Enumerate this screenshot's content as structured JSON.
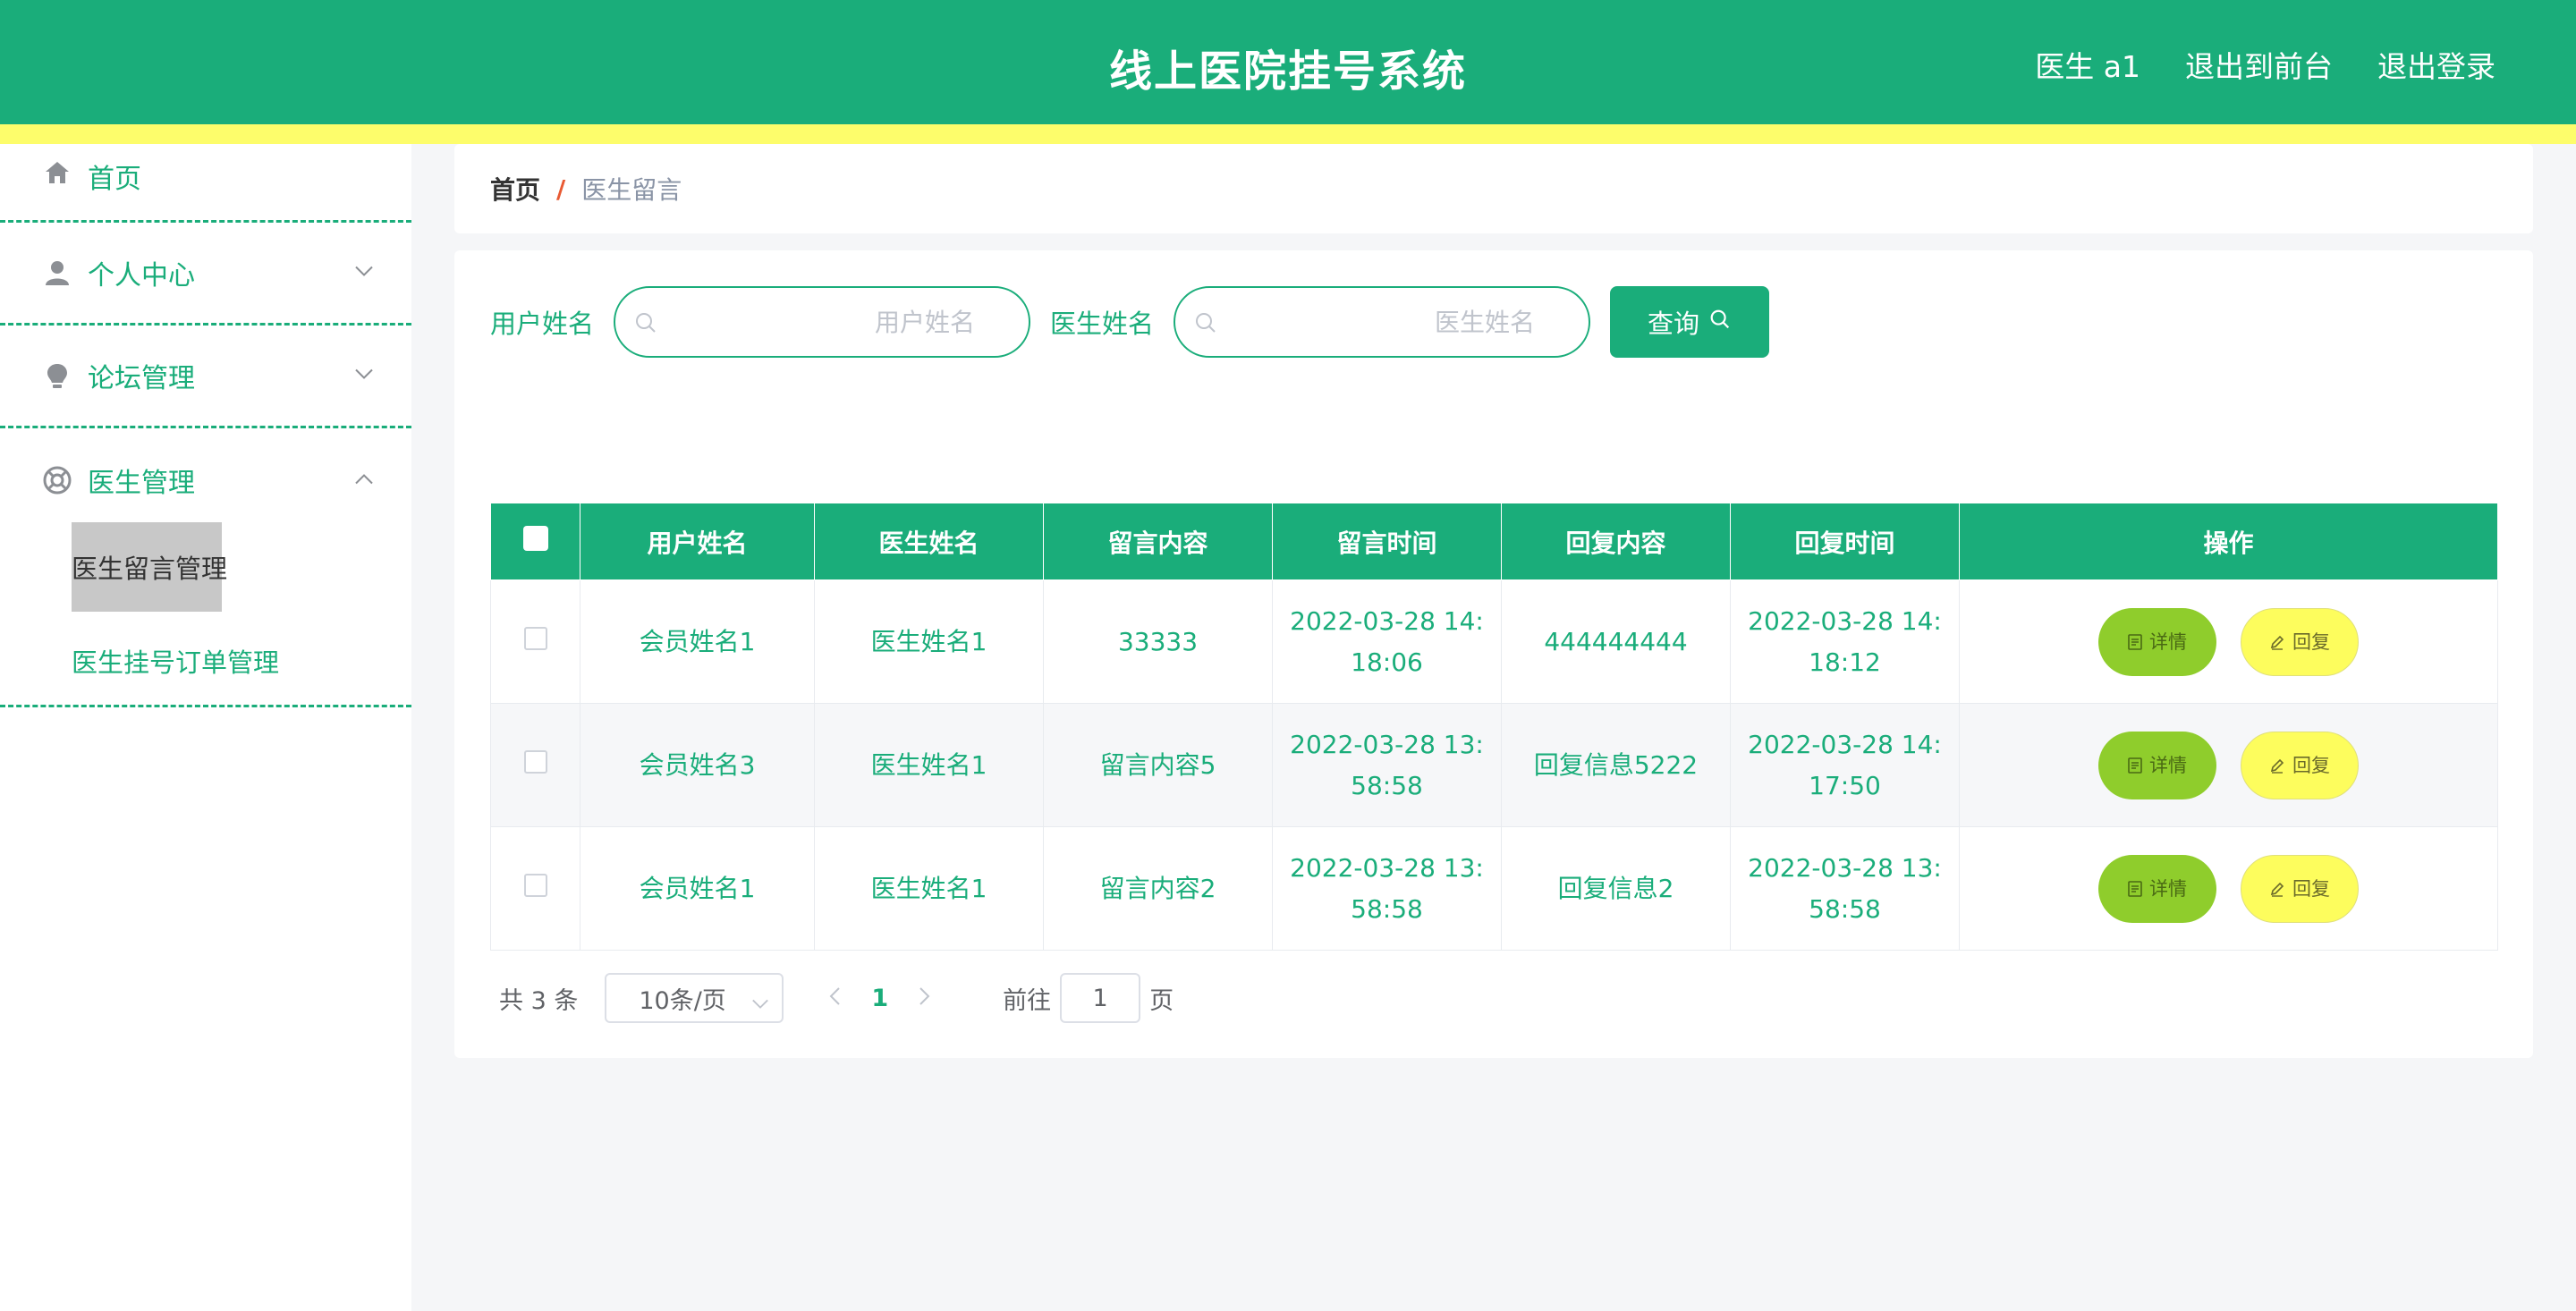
{
  "header": {
    "title": "线上医院挂号系统",
    "user": "医生 a1",
    "back_front": "退出到前台",
    "logout": "退出登录"
  },
  "sidebar": {
    "items": [
      {
        "label": "首页",
        "icon": "home-icon"
      },
      {
        "label": "个人中心",
        "icon": "user-icon"
      },
      {
        "label": "论坛管理",
        "icon": "bulb-icon"
      },
      {
        "label": "医生管理",
        "icon": "lifebuoy-icon"
      }
    ],
    "sub_items": [
      {
        "label": "医生留言管理",
        "active": true
      },
      {
        "label": "医生挂号订单管理",
        "active": false
      }
    ]
  },
  "breadcrumb": {
    "home": "首页",
    "separator": "/",
    "current": "医生留言"
  },
  "search": {
    "user_label": "用户姓名",
    "user_placeholder": "用户姓名",
    "doctor_label": "医生姓名",
    "doctor_placeholder": "医生姓名",
    "query_label": "查询"
  },
  "table": {
    "columns": [
      "用户姓名",
      "医生姓名",
      "留言内容",
      "留言时间",
      "回复内容",
      "回复时间",
      "操作"
    ],
    "rows": [
      {
        "user": "会员姓名1",
        "doctor": "医生姓名1",
        "content": "33333",
        "time_a": "2022-03-28 14:",
        "time_b": "18:06",
        "reply": "444444444",
        "rtime_a": "2022-03-28 14:",
        "rtime_b": "18:12"
      },
      {
        "user": "会员姓名3",
        "doctor": "医生姓名1",
        "content": "留言内容5",
        "time_a": "2022-03-28 13:",
        "time_b": "58:58",
        "reply": "回复信息5222",
        "rtime_a": "2022-03-28 14:",
        "rtime_b": "17:50"
      },
      {
        "user": "会员姓名1",
        "doctor": "医生姓名1",
        "content": "留言内容2",
        "time_a": "2022-03-28 13:",
        "time_b": "58:58",
        "reply": "回复信息2",
        "rtime_a": "2022-03-28 13:",
        "rtime_b": "58:58"
      }
    ],
    "detail_label": "详情",
    "reply_label": "回复"
  },
  "pager": {
    "total": "共 3 条",
    "page_size": "10条/页",
    "current_page": "1",
    "goto_label": "前往",
    "goto_value": "1",
    "goto_unit": "页"
  },
  "colors": {
    "primary": "#1aad7a",
    "stripe": "#fdfd6b",
    "detail_button": "#8fcd2c",
    "reply_button": "#fdfd5d"
  }
}
